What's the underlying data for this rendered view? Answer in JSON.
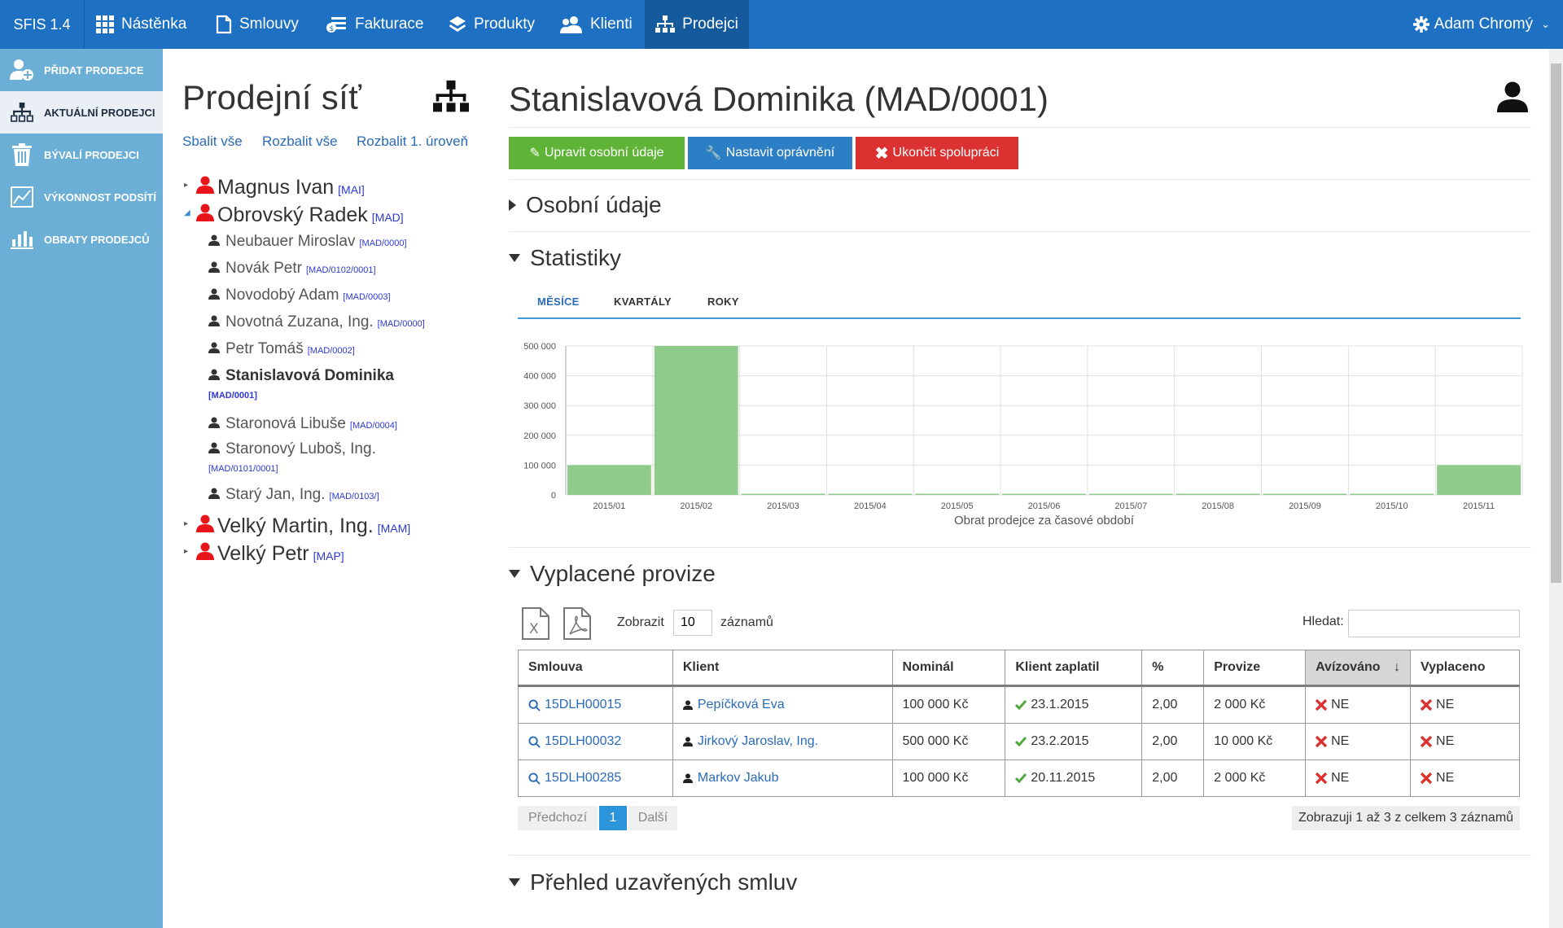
{
  "app": {
    "brand": "SFIS 1.4"
  },
  "nav": [
    {
      "label": "Nástěnka",
      "icon": "grid-icon"
    },
    {
      "label": "Smlouvy",
      "icon": "document-icon"
    },
    {
      "label": "Fakturace",
      "icon": "invoice-icon"
    },
    {
      "label": "Produkty",
      "icon": "layers-icon"
    },
    {
      "label": "Klienti",
      "icon": "users-icon"
    },
    {
      "label": "Prodejci",
      "icon": "sitemap-icon"
    }
  ],
  "user": {
    "name": "Adam Chromý"
  },
  "sidebar": [
    {
      "label": "PŘIDAT PRODEJCE",
      "icon": "add-user-icon"
    },
    {
      "label": "AKTUÁLNÍ PRODEJCI",
      "icon": "sitemap-icon"
    },
    {
      "label": "BÝVALÍ PRODEJCI",
      "icon": "trash-icon"
    },
    {
      "label": "VÝKONNOST PODSÍTÍ",
      "icon": "line-chart-icon"
    },
    {
      "label": "OBRATY PRODEJCŮ",
      "icon": "bar-chart-icon"
    }
  ],
  "tree": {
    "title": "Prodejní síť",
    "links": [
      "Sbalit vše",
      "Rozbalit vše",
      "Rozbalit 1. úroveň"
    ],
    "top1": [
      {
        "name": "Magnus Ivan",
        "code": "[MAI]"
      },
      {
        "name": "Obrovský Radek",
        "code": "[MAD]"
      }
    ],
    "children": [
      {
        "name": "Neubauer Miroslav",
        "code": "[MAD/0000]"
      },
      {
        "name": "Novák Petr",
        "code": "[MAD/0102/0001]"
      },
      {
        "name": "Novodobý Adam",
        "code": "[MAD/0003]"
      },
      {
        "name": "Novotná Zuzana, Ing.",
        "code": "[MAD/0000]"
      },
      {
        "name": "Petr Tomáš",
        "code": "[MAD/0002]"
      },
      {
        "name": "Stanislavová Dominika",
        "code": "[MAD/0001]"
      },
      {
        "name": "Staronová Libuše",
        "code": "[MAD/0004]"
      },
      {
        "name": "Staronový Luboš, Ing.",
        "code": "[MAD/0101/0001]"
      },
      {
        "name": "Starý Jan, Ing.",
        "code": "[MAD/0103/]"
      }
    ],
    "top2": [
      {
        "name": "Velký Martin, Ing.",
        "code": "[MAM]"
      },
      {
        "name": "Velký Petr",
        "code": "[MAP]"
      }
    ]
  },
  "main": {
    "title": "Stanislavová Dominika (MAD/0001)",
    "buttons": {
      "edit": "Upravit osobní údaje",
      "perm": "Nastavit oprávnění",
      "end": "Ukončit spolupráci"
    },
    "sections": {
      "personal": "Osobní údaje",
      "stats": "Statistiky",
      "commissions": "Vyplacené provize",
      "contracts": "Přehled uzavřených smluv"
    },
    "tabs": [
      "MĚSÍCE",
      "KVARTÁLY",
      "ROKY"
    ]
  },
  "chart_data": {
    "type": "bar",
    "categories": [
      "2015/01",
      "2015/02",
      "2015/03",
      "2015/04",
      "2015/05",
      "2015/06",
      "2015/07",
      "2015/08",
      "2015/09",
      "2015/10",
      "2015/11"
    ],
    "values": [
      100000,
      500000,
      0,
      0,
      0,
      0,
      0,
      0,
      0,
      0,
      100000
    ],
    "yticks": [
      "0",
      "100 000",
      "200 000",
      "300 000",
      "400 000",
      "500 000"
    ],
    "ylim": [
      0,
      500000
    ],
    "xlabel": "Obrat prodejce za časové období",
    "grid": true,
    "color": "#8fcb8a"
  },
  "table": {
    "show_label": "Zobrazit",
    "show_count": "10",
    "records_label": "záznamů",
    "search_label": "Hledat:",
    "columns": [
      "Smlouva",
      "Klient",
      "Nominál",
      "Klient zaplatil",
      "%",
      "Provize",
      "Avízováno",
      "Vyplaceno"
    ],
    "sort_arrow": "↓",
    "rows": [
      {
        "contract": "15DLH00015",
        "client": "Pepíčková Eva",
        "nominal": "100 000 Kč",
        "paid": "23.1.2015",
        "pct": "2,00",
        "commission": "2 000 Kč",
        "advised": "NE",
        "payed": "NE"
      },
      {
        "contract": "15DLH00032",
        "client": "Jirkový Jaroslav, Ing.",
        "nominal": "500 000 Kč",
        "paid": "23.2.2015",
        "pct": "2,00",
        "commission": "10 000 Kč",
        "advised": "NE",
        "payed": "NE"
      },
      {
        "contract": "15DLH00285",
        "client": "Markov Jakub",
        "nominal": "100 000 Kč",
        "paid": "20.11.2015",
        "pct": "2,00",
        "commission": "2 000 Kč",
        "advised": "NE",
        "payed": "NE"
      }
    ],
    "pager": {
      "prev": "Předchozí",
      "page": "1",
      "next": "Další"
    },
    "info": "Zobrazuji 1 až 3 z celkem 3 záznamů"
  },
  "colors": {
    "topbar": "#1d70c2",
    "sidebar": "#6baed6",
    "green": "#5fb336",
    "blue": "#2c7fc4",
    "red": "#dc3131"
  }
}
